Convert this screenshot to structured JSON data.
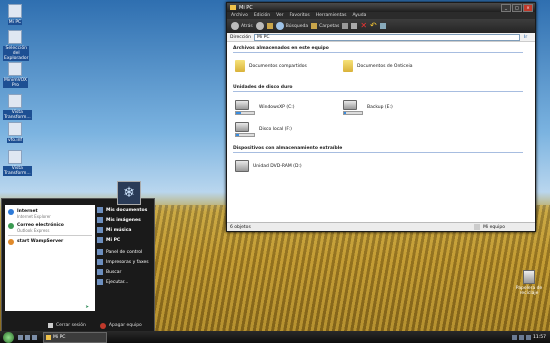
{
  "desktop": {
    "icons": [
      {
        "label": "Mi PC",
        "icon": "computer-icon"
      },
      {
        "label": "Selección del Explorador",
        "icon": "explorer-icon"
      },
      {
        "label": "MinimVOX Pro",
        "icon": "audio-app-icon"
      },
      {
        "label": "Vista Transform...",
        "icon": "transform-icon"
      },
      {
        "label": "vfo.inf",
        "icon": "file-icon"
      },
      {
        "label": "Vista Transform...",
        "icon": "transform-icon"
      }
    ],
    "recycle_bin": "Papelera de reciclaje"
  },
  "window": {
    "title": "Mi PC",
    "menu": [
      "Archivo",
      "Edición",
      "Ver",
      "Favoritos",
      "Herramientas",
      "Ayuda"
    ],
    "toolbar": {
      "back": "Atrás",
      "search": "Búsqueda",
      "folders": "Carpetas"
    },
    "address_label": "Dirección",
    "address_value": "Mi PC",
    "address_go": "Ir",
    "sections": {
      "stored": "Archivos almacenados en este equipo",
      "hdd": "Unidades de disco duro",
      "removable": "Dispositivos con almacenamiento extraíble"
    },
    "stored_items": [
      "Documentos compartidos",
      "Documentos de Onticeia"
    ],
    "drives": [
      {
        "label": "WindowsXP (C:)",
        "usage": 0.3
      },
      {
        "label": "Backup (E:)",
        "usage": 0.1
      },
      {
        "label": "Disco local (F:)",
        "usage": 0.15
      }
    ],
    "removable_items": [
      "Unidad DVD-RAM (D:)"
    ],
    "status_left": "6 objetos",
    "status_right": "Mi equipo"
  },
  "start_menu": {
    "pinned": [
      {
        "title": "Internet",
        "sub": "Internet Explorer"
      },
      {
        "title": "Correo electrónico",
        "sub": "Outlook Express"
      }
    ],
    "recent": [
      {
        "title": "start WampServer"
      }
    ],
    "all_programs": "Todos los programas",
    "right": [
      "Mis documentos",
      "Mis imágenes",
      "Mi música",
      "Mi PC",
      "Panel de control",
      "Impresoras y faxes",
      "Buscar",
      "Ejecutar..."
    ],
    "logoff": "Cerrar sesión",
    "shutdown": "Apagar equipo"
  },
  "taskbar": {
    "task_label": "Mi PC",
    "clock": "11:57"
  },
  "colors": {
    "accent": "#1d4f93",
    "toolbar_dark": "#252525",
    "highlight_blue": "#2d7ad8"
  }
}
